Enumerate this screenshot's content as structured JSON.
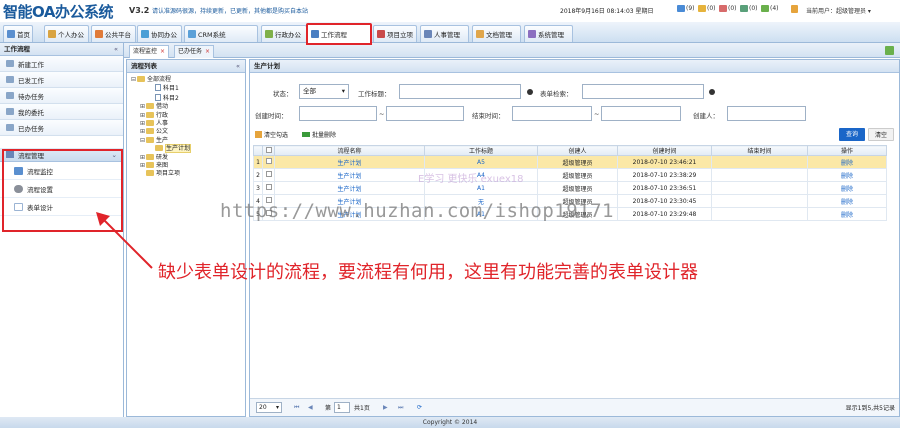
{
  "header": {
    "app_title": "智能OA办公系统",
    "version": "V3.2",
    "notice": "请认准源码很源，持续更新，已更新，其他都是购买自本站",
    "datetime": "2018年9月16日 08:14:03 星期日",
    "counters": [
      "(9)",
      "(0)",
      "(0)",
      "(0)",
      "(4)"
    ],
    "current_user": "当前用户：超级管理员 ▾"
  },
  "nav": {
    "tabs": [
      {
        "label": "首页",
        "color": "#5a8fcf"
      },
      {
        "label": "个人办公",
        "color": "#d9a441"
      },
      {
        "label": "公共平台",
        "color": "#e07b39"
      },
      {
        "label": "协同办公",
        "color": "#4a9fd6"
      },
      {
        "label": "CRM系统",
        "color": "#5aa0d8"
      },
      {
        "label": "行政办公",
        "color": "#7fb04a"
      },
      {
        "label": "工作流程",
        "color": "#4b7fc2"
      },
      {
        "label": "项目立项",
        "color": "#c94a4a"
      },
      {
        "label": "人事管理",
        "color": "#6a86b8"
      },
      {
        "label": "文档管理",
        "color": "#e0a64b"
      },
      {
        "label": "系统管理",
        "color": "#8c6fc0"
      }
    ]
  },
  "left": {
    "title": "工作流程",
    "collapse": "«",
    "items": [
      "新建工作",
      "已发工作",
      "待办任务",
      "我的委托",
      "已办任务"
    ],
    "group": "流程管理",
    "sub_items": [
      {
        "label": "流程监控",
        "color": "#5a8fcf"
      },
      {
        "label": "流程设置",
        "color": "#8a8f99"
      },
      {
        "label": "表单设计",
        "color": "#9bb4d4"
      }
    ]
  },
  "content_tabs": [
    {
      "label": "流程监控",
      "close": "×"
    },
    {
      "label": "已办任务",
      "close": "×"
    }
  ],
  "tree": {
    "title": "流程列表",
    "collapse": "«",
    "nodes": [
      {
        "label": "全部流程",
        "indent": 0,
        "pm": "⊟",
        "type": "root"
      },
      {
        "label": "科目1",
        "indent": 2,
        "pm": "",
        "type": "doc"
      },
      {
        "label": "科目2",
        "indent": 2,
        "pm": "",
        "type": "doc"
      },
      {
        "label": "借动",
        "indent": 1,
        "pm": "⊞",
        "type": "folder"
      },
      {
        "label": "行政",
        "indent": 1,
        "pm": "⊞",
        "type": "folder"
      },
      {
        "label": "人事",
        "indent": 1,
        "pm": "⊞",
        "type": "folder"
      },
      {
        "label": "公文",
        "indent": 1,
        "pm": "⊞",
        "type": "folder"
      },
      {
        "label": "生产",
        "indent": 1,
        "pm": "⊟",
        "type": "folder"
      },
      {
        "label": "生产计划",
        "indent": 2,
        "pm": "",
        "type": "selected"
      },
      {
        "label": "研发",
        "indent": 1,
        "pm": "⊞",
        "type": "folder"
      },
      {
        "label": "来图",
        "indent": 1,
        "pm": "⊞",
        "type": "folder"
      },
      {
        "label": "项目立项",
        "indent": 1,
        "pm": "",
        "type": "folder"
      }
    ]
  },
  "main": {
    "title": "生产计划",
    "filters": {
      "status_label": "状态：",
      "status_value": "全部",
      "title_label": "工作标题：",
      "form_search_label": "表单检索：",
      "created_label": "创建时间：",
      "dash": "~",
      "end_label": "结束时间：",
      "creator_label": "创建人："
    },
    "toolbar": {
      "clear_check": "清空勾选",
      "batch_delete": "批量删除",
      "search": "查询",
      "clear": "清空"
    },
    "columns": [
      "流程名称",
      "工作标题",
      "创建人",
      "创建时间",
      "结束时间",
      "操作"
    ],
    "rows": [
      {
        "n": "1",
        "name": "生产计划",
        "title": "A5",
        "creator": "超级管理员",
        "created": "2018-07-10 23:46:21",
        "ended": "",
        "op": "删除"
      },
      {
        "n": "2",
        "name": "生产计划",
        "title": "A4",
        "creator": "超级管理员",
        "created": "2018-07-10 23:38:29",
        "ended": "",
        "op": "删除"
      },
      {
        "n": "3",
        "name": "生产计划",
        "title": "A1",
        "creator": "超级管理员",
        "created": "2018-07-10 23:36:51",
        "ended": "",
        "op": "删除"
      },
      {
        "n": "4",
        "name": "生产计划",
        "title": "无",
        "creator": "超级管理员",
        "created": "2018-07-10 23:30:45",
        "ended": "",
        "op": "删除"
      },
      {
        "n": "5",
        "name": "生产计划",
        "title": "A1",
        "creator": "超级管理员",
        "created": "2018-07-10 23:29:48",
        "ended": "",
        "op": "删除"
      }
    ],
    "pager": {
      "page_size": "20",
      "page_prefix": "第",
      "page_value": "1",
      "page_suffix": "共1页",
      "summary": "显示1到5,共5记录"
    }
  },
  "footer": "Copyright © 2014",
  "overlay": {
    "watermark": "https://www.huzhan.com/ishop19171",
    "watermark2": "E学习 更快乐 exuex18",
    "annotation": "缺少表单设计的流程，要流程有何用，这里有功能完善的表单设计器"
  }
}
